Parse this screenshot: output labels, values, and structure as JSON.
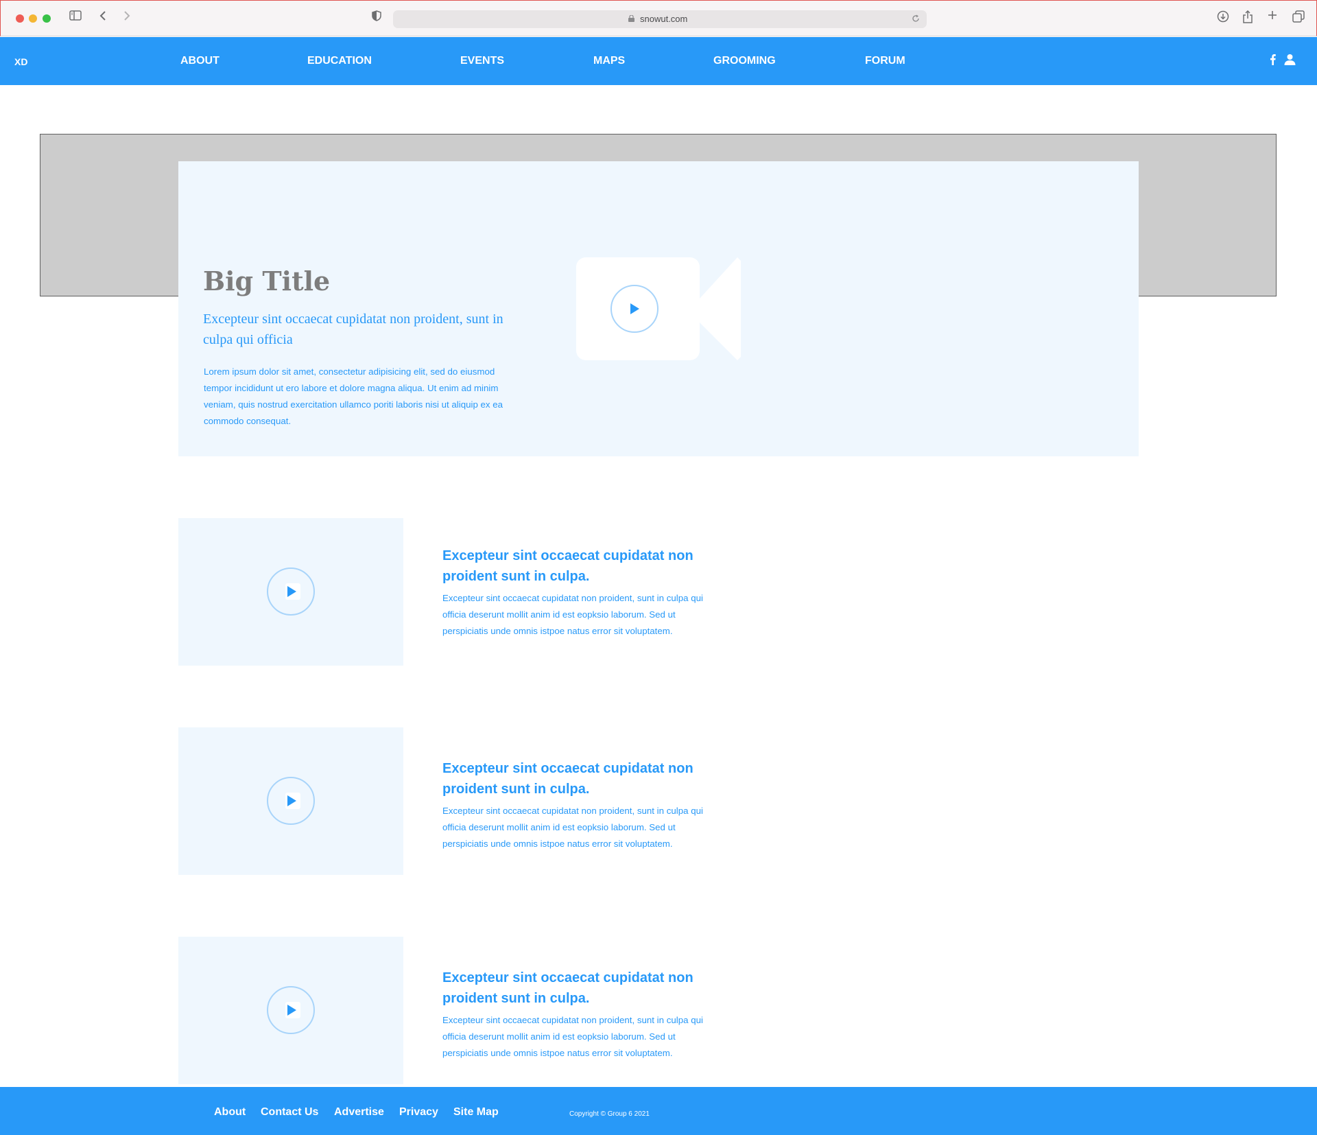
{
  "browser": {
    "url": "snowut.com"
  },
  "nav": {
    "logo": "XD",
    "items": [
      "ABOUT",
      "EDUCATION",
      "EVENTS",
      "MAPS",
      "GROOMING",
      "FORUM"
    ]
  },
  "hero": {
    "title": "Big Title",
    "subtitle": "Excepteur sint occaecat cupidatat non proident, sunt in culpa qui officia",
    "body": "Lorem ipsum dolor sit amet, consectetur adipisicing elit, sed do eiusmod tempor incididunt ut ero labore et dolore magna aliqua. Ut enim ad minim veniam, quis nostrud exercitation ullamco poriti laboris nisi ut aliquip ex ea commodo consequat."
  },
  "items": [
    {
      "title": "Excepteur sint occaecat cupidatat non proident sunt in culpa.",
      "text": "Excepteur sint occaecat cupidatat non proident, sunt in culpa qui officia deserunt mollit anim id est eopksio laborum. Sed ut perspiciatis unde omnis istpoe natus error sit voluptatem."
    },
    {
      "title": "Excepteur sint occaecat cupidatat non proident sunt in culpa.",
      "text": "Excepteur sint occaecat cupidatat non proident, sunt in culpa qui officia deserunt mollit anim id est eopksio laborum. Sed ut perspiciatis unde omnis istpoe natus error sit voluptatem."
    },
    {
      "title": "Excepteur sint occaecat cupidatat non proident sunt in culpa.",
      "text": "Excepteur sint occaecat cupidatat non proident, sunt in culpa qui officia deserunt mollit anim id est eopksio laborum. Sed ut perspiciatis unde omnis istpoe natus error sit voluptatem."
    }
  ],
  "footer": {
    "links": [
      "About",
      "Contact Us",
      "Advertise",
      "Privacy",
      "Site Map"
    ],
    "copyright": "Copyright © Group 6 2021"
  },
  "colors": {
    "brand": "#2899f8",
    "card": "#eff7fe",
    "hero_bg": "#cccccc",
    "title_gray": "#7d7d7d"
  },
  "icons": {
    "nav_social": [
      "facebook-icon",
      "user-icon"
    ],
    "media": [
      "video-camera-icon",
      "play-icon"
    ]
  }
}
